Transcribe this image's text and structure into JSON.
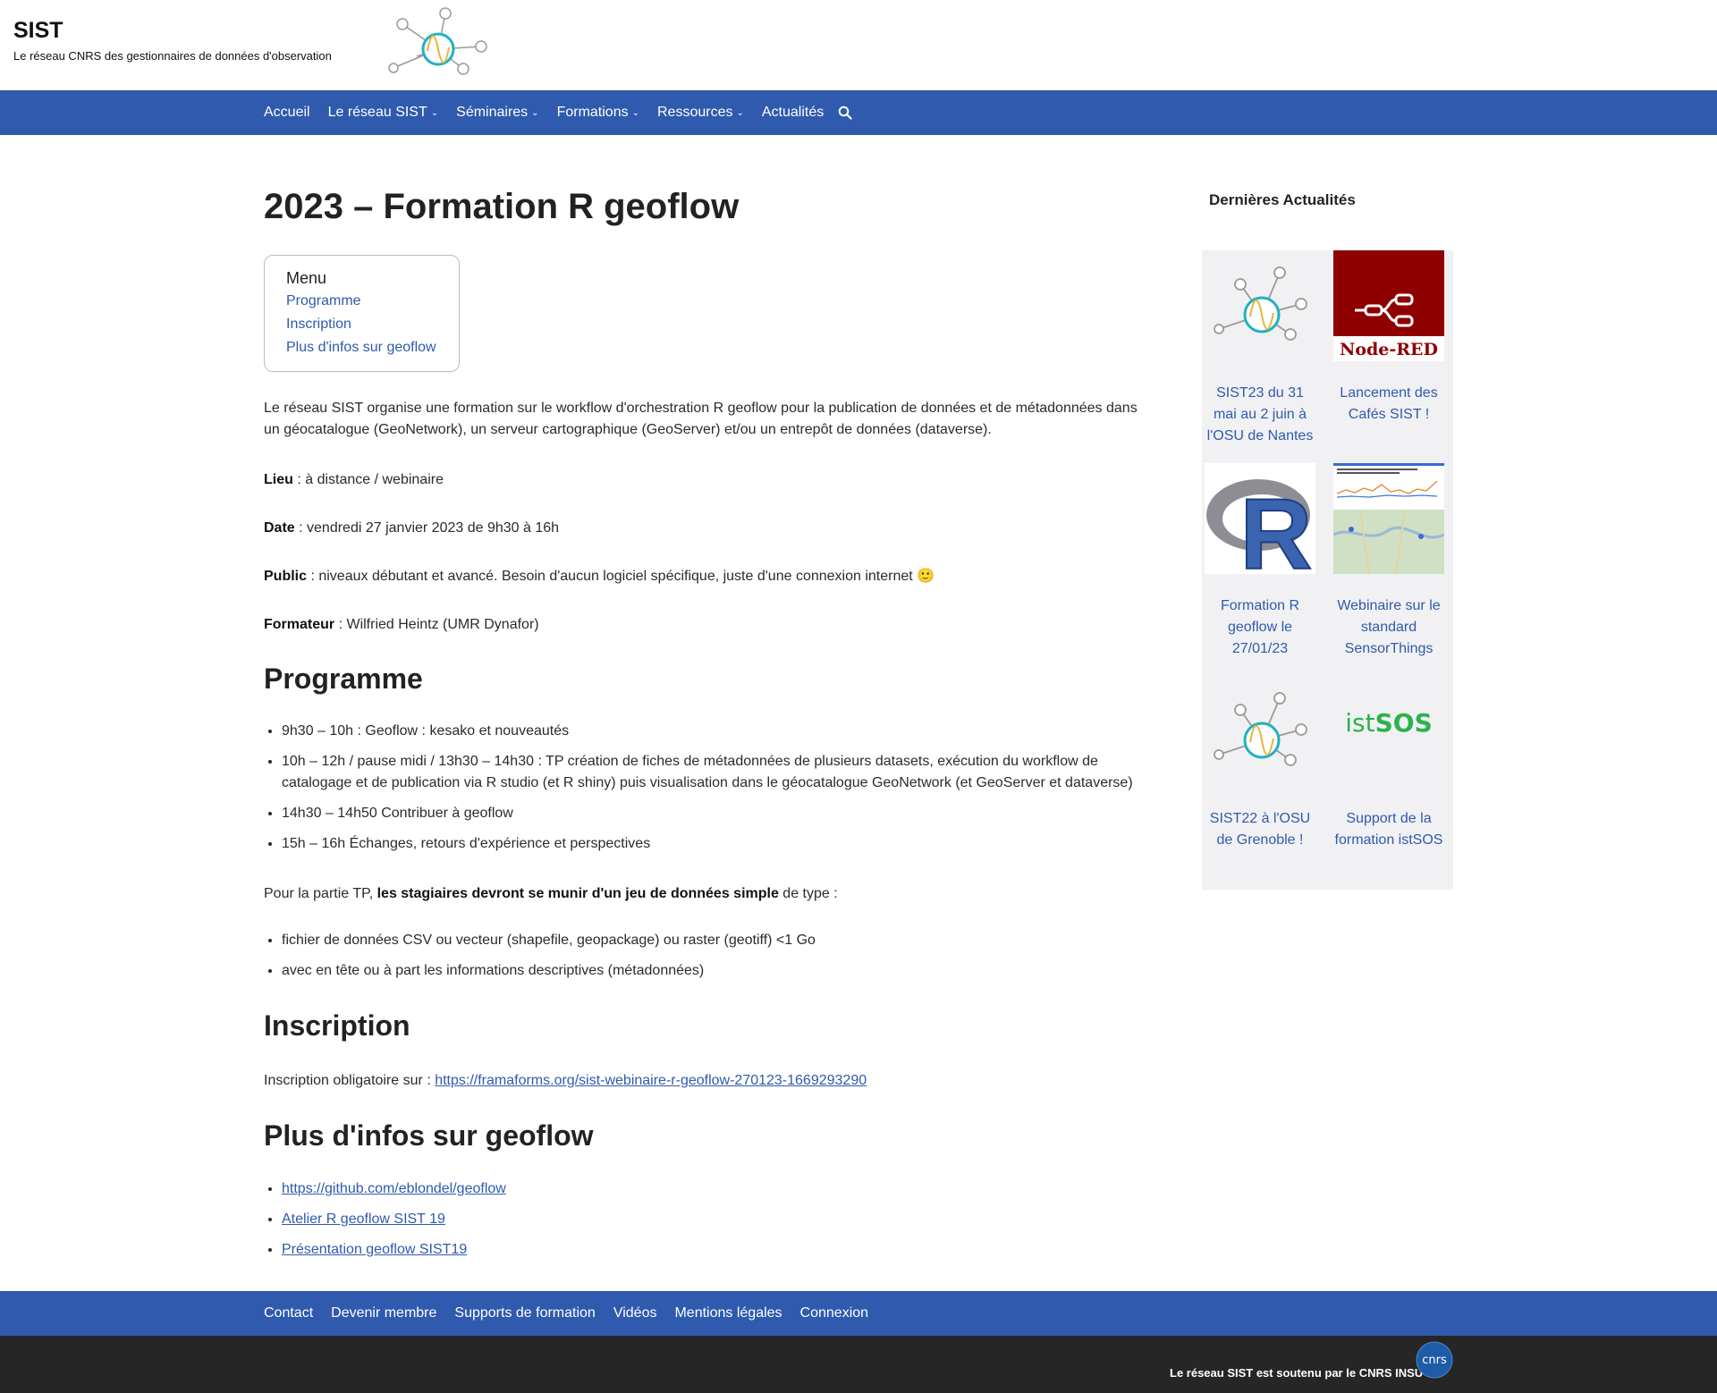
{
  "header": {
    "site_title": "SIST",
    "tagline": "Le réseau CNRS des gestionnaires de données d'observation"
  },
  "nav": {
    "items": [
      {
        "label": "Accueil",
        "dropdown": false
      },
      {
        "label": "Le réseau SIST",
        "dropdown": true
      },
      {
        "label": "Séminaires",
        "dropdown": true
      },
      {
        "label": "Formations",
        "dropdown": true
      },
      {
        "label": "Ressources",
        "dropdown": true
      },
      {
        "label": "Actualités",
        "dropdown": false
      }
    ],
    "chevron": "⌄",
    "search_icon": "search-icon"
  },
  "article": {
    "title": "2023 – Formation R geoflow",
    "toc": {
      "title": "Menu",
      "items": [
        "Programme",
        "Inscription",
        "Plus d'infos sur geoflow"
      ]
    },
    "intro": "Le réseau SIST organise une formation sur le workflow d'orchestration R geoflow pour la publication de données et de métadonnées dans un géocatalogue (GeoNetwork), un serveur cartographique (GeoServer) et/ou un entrepôt de données (dataverse).",
    "lieu_label": "Lieu",
    "lieu_value": " : à distance / webinaire",
    "date_label": "Date",
    "date_value": " : vendredi 27 janvier 2023 de 9h30 à 16h",
    "public_label": "Public",
    "public_value": " : niveaux débutant et avancé. Besoin d'aucun logiciel spécifique, juste d'une connexion internet 🙂",
    "formateur_label": "Formateur",
    "formateur_value": " : Wilfried Heintz (UMR Dynafor)",
    "programme_heading": "Programme",
    "programme_items": [
      "9h30 – 10h : Geoflow : kesako et nouveautés",
      "10h – 12h / pause midi / 13h30 – 14h30 : TP création de fiches de métadonnées de plusieurs datasets, exécution du workflow de catalogage et de publication via R studio (et R shiny) puis visualisation dans le géocatalogue GeoNetwork (et GeoServer et dataverse)",
      "14h30 – 14h50 Contribuer à geoflow",
      "15h – 16h Échanges, retours d'expérience et perspectives"
    ],
    "tp_prefix": "Pour la partie TP, ",
    "tp_bold": "les stagiaires devront se munir d'un jeu de données simple",
    "tp_suffix": " de type :",
    "tp_items": [
      "fichier de données CSV ou vecteur (shapefile, geopackage) ou raster (geotiff) <1 Go",
      "avec en tête ou à part les informations descriptives (métadonnées)"
    ],
    "inscription_heading": "Inscription",
    "inscription_prefix": "Inscription obligatoire sur : ",
    "inscription_link": "https://framaforms.org/sist-webinaire-r-geoflow-270123-1669293290",
    "infos_heading": "Plus d'infos sur geoflow",
    "infos_links": [
      "https://github.com/eblondel/geoflow",
      "Atelier R geoflow SIST 19",
      "Présentation geoflow SIST19"
    ]
  },
  "sidebar": {
    "title": "Dernières Actualités",
    "news": [
      {
        "label": "SIST23 du 31 mai au 2 juin à l'OSU de Nantes",
        "thumb": "sist-logo"
      },
      {
        "label": "Lancement des Cafés SIST !",
        "thumb": "node-red-logo",
        "thumb_text": "Node-RED"
      },
      {
        "label": "Formation R geoflow le 27/01/23",
        "thumb": "r-logo",
        "thumb_text": "R"
      },
      {
        "label": "Webinaire sur le standard SensorThings",
        "thumb": "sensorthings-screenshot"
      },
      {
        "label": "SIST22 à l'OSU de Grenoble !",
        "thumb": "sist-logo"
      },
      {
        "label": "Support de la formation istSOS",
        "thumb": "istsos-logo",
        "thumb_text_1": "ist",
        "thumb_text_2": "SOS"
      }
    ]
  },
  "footer": {
    "items": [
      "Contact",
      "Devenir membre",
      "Supports de formation",
      "Vidéos",
      "Mentions légales",
      "Connexion"
    ],
    "credit_prefix": "Le réseau SIST est soutenu par le ",
    "credit_link": "CNRS INSU",
    "cnrs_logo_text": "cnrs"
  },
  "colors": {
    "brand_blue": "#2f5aae",
    "footer_dark": "#262626",
    "logo_teal": "#1fb1c2",
    "logo_yellow": "#e6b43a",
    "node_red": "#8f0000",
    "istsos_green": "#2bb24c"
  }
}
